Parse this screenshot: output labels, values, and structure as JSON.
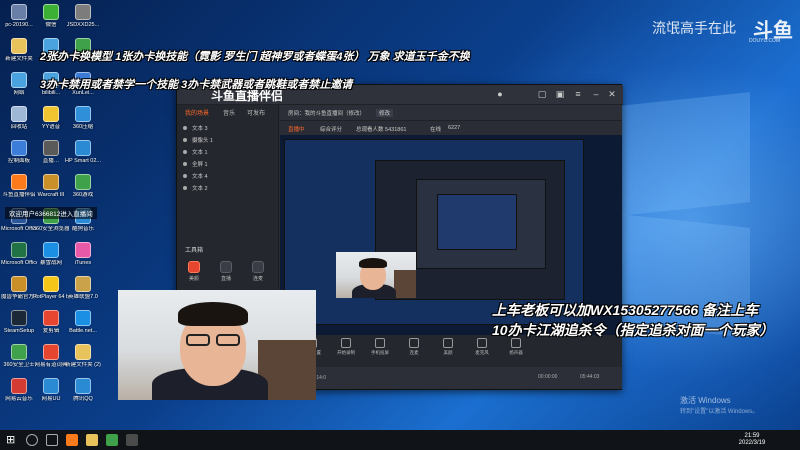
{
  "watermark": {
    "text": "流氓高手在此",
    "logo": "斗鱼",
    "url": "DOUYU.COM"
  },
  "overlay": {
    "line1": "2张办卡换模型 1张办卡换技能（霓影 罗生门 超神罗或者蝶蛋4张） 万象 求道玉千金不换",
    "line2": "3办卡禁用或者禁学一个技能 3办卡禁武器或者跳鞋或者禁止邀请",
    "subtitle1": "上车老板可以加WX15305277566 备注上车",
    "subtitle2": "10办卡江湖追杀令（指定追杀对面一个玩家）"
  },
  "desktop_icons": [
    {
      "label": "pc-20190...",
      "color": "#6a7fa8"
    },
    {
      "label": "微信",
      "color": "#3cb034"
    },
    {
      "label": "JSDXXD25...",
      "color": "#7c7c7c"
    },
    {
      "label": "新建文件夹",
      "color": "#e8c25a"
    },
    {
      "label": "此电脑",
      "color": "#4aa3df"
    },
    {
      "label": "360...",
      "color": "#3fa24a"
    },
    {
      "label": "网络",
      "color": "#4aa3df"
    },
    {
      "label": "bilibili...",
      "color": "#4aa3df"
    },
    {
      "label": "XunLei...",
      "color": "#3a7bd5"
    },
    {
      "label": "回收站",
      "color": "#9fb7d6"
    },
    {
      "label": "YY语音",
      "color": "#f0c330"
    },
    {
      "label": "360压缩",
      "color": "#2f8fd8"
    },
    {
      "label": "控制面板",
      "color": "#3b7dd8"
    },
    {
      "label": "直播…",
      "color": "#5a5a5a"
    },
    {
      "label": "HP Smart 02...",
      "color": "#2a8ad4"
    },
    {
      "label": "斗鱼直播伴侣",
      "color": "#ff7a1a"
    },
    {
      "label": "Warcraft III",
      "color": "#c9902a"
    },
    {
      "label": "360游戏",
      "color": "#3fa24a"
    },
    {
      "label": "Microsoft Office Wo...",
      "color": "#2b579a"
    },
    {
      "label": "360安全浏览器",
      "color": "#3fa24a"
    },
    {
      "label": "酷狗音乐",
      "color": "#2a8ad4"
    },
    {
      "label": "Microsoft Office Exc...",
      "color": "#217346"
    },
    {
      "label": "暴雪战网",
      "color": "#1a8fe3"
    },
    {
      "label": "iTunes",
      "color": "#e85aa8"
    },
    {
      "label": "魔兽争霸官方对战平台",
      "color": "#c9902a"
    },
    {
      "label": "PotPlayer 64 bit",
      "color": "#f5c518"
    },
    {
      "label": "英雄联盟7.0",
      "color": "#c9a24a"
    },
    {
      "label": "SteamSetup",
      "color": "#1b2838"
    },
    {
      "label": "爱剪辑",
      "color": "#e6452f"
    },
    {
      "label": "Battle.net...",
      "color": "#1a8fe3"
    },
    {
      "label": "360安全卫士",
      "color": "#3fa24a"
    },
    {
      "label": "网易有道词典",
      "color": "#e6452f"
    },
    {
      "label": "新建文件夹 (2)",
      "color": "#e8c25a"
    },
    {
      "label": "网易云音乐",
      "color": "#d43c33"
    },
    {
      "label": "网易UU",
      "color": "#2a8ad4"
    },
    {
      "label": "腾讯QQ",
      "color": "#2a8ad4"
    }
  ],
  "chat_notice": "欢迎用户6366812进入直播间",
  "app": {
    "logo": "斗鱼直播伴侣",
    "left_tabs": [
      "我的场景",
      "音乐",
      "可发布"
    ],
    "sources": [
      "文本 3",
      "摄像头 1",
      "文本 1",
      "全屏 1",
      "文本 4",
      "文本 2"
    ],
    "tools_label": "工具箱",
    "tools": [
      "美颜",
      "直播",
      "连麦",
      "直播助手",
      "弹幕",
      "主播"
    ],
    "room_title": "房间：我的斗鱼直播间（修改）",
    "room_btn": "修改",
    "stats": [
      "直播中",
      "综合评分",
      "总观看人数 5431861",
      "在线",
      "6227"
    ],
    "controls": [
      "直播设置",
      "开始录制",
      "手机投屏",
      "连麦",
      "美颜",
      "麦克风",
      "扬声器"
    ],
    "bottom_left": "直播时长 00:14:0",
    "bottom_time1": "00:00:00",
    "bottom_time2": "05:44:03"
  },
  "activation": {
    "line1": "激活 Windows",
    "line2": "转到\"设置\"以激活 Windows。"
  },
  "taskbar": {
    "time": "21:59",
    "date": "2022/3/19"
  }
}
